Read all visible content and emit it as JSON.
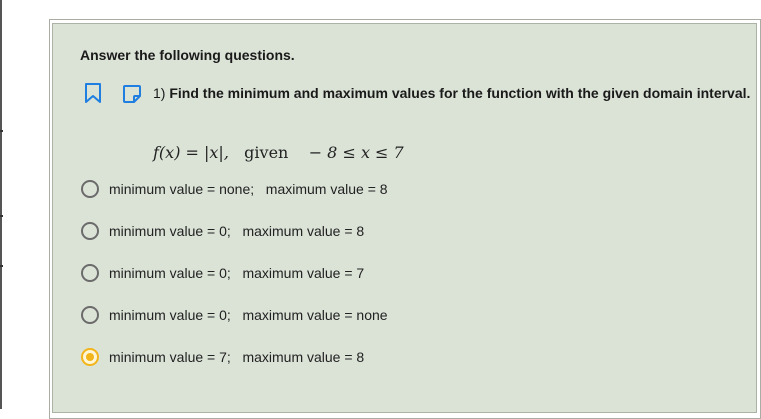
{
  "instruction": "Answer the following questions.",
  "question": {
    "number": "1)",
    "text": "Find the minimum and maximum values for the function with the given domain interval.",
    "formula": {
      "lhs": "f(x) = |x|,",
      "given_word": "given",
      "domain": "− 8 ≤ x ≤ 7"
    }
  },
  "options": [
    {
      "label": "minimum value = none;   maximum value = 8",
      "selected": false
    },
    {
      "label": "minimum value = 0;   maximum value = 8",
      "selected": false
    },
    {
      "label": "minimum value = 0;   maximum value = 7",
      "selected": false
    },
    {
      "label": "minimum value = 0;   maximum value = none",
      "selected": false
    },
    {
      "label": "minimum value = 7;   maximum value = 8",
      "selected": true
    }
  ],
  "icons": {
    "bookmark": "bookmark-icon",
    "note": "note-icon"
  },
  "colors": {
    "accent_blue": "#1f7ee0",
    "selected_radio": "#f2b51c",
    "panel_bg": "#dbe3d7"
  }
}
